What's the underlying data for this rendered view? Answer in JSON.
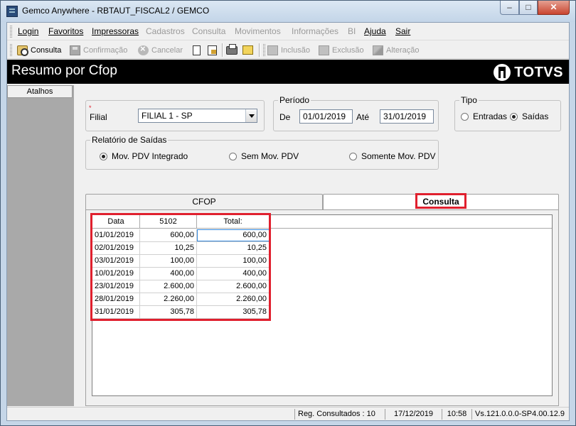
{
  "window": {
    "title": "Gemco Anywhere - RBTAUT_FISCAL2 / GEMCO",
    "min": "–",
    "max": "□",
    "close": "✕"
  },
  "menu": [
    {
      "label": "Login",
      "enabled": true
    },
    {
      "label": "Favoritos",
      "enabled": true
    },
    {
      "label": "Impressoras",
      "enabled": true
    },
    {
      "label": "Cadastros",
      "enabled": false
    },
    {
      "label": "Consulta",
      "enabled": false
    },
    {
      "label": "Movimentos",
      "enabled": false
    },
    {
      "label": "Informações",
      "enabled": false
    },
    {
      "label": "BI",
      "enabled": false
    },
    {
      "label": "Ajuda",
      "enabled": true
    },
    {
      "label": "Sair",
      "enabled": true
    }
  ],
  "toolbar": {
    "consulta": "Consulta",
    "confirmacao": "Confirmação",
    "cancelar": "Cancelar",
    "inclusao": "Inclusão",
    "exclusao": "Exclusão",
    "alteracao": "Alteração"
  },
  "header": {
    "title": "Resumo por Cfop",
    "brand": "TOTVS"
  },
  "sidebar": {
    "atalhos": "Atalhos"
  },
  "filter": {
    "filial_label": "Filial",
    "filial_value": "FILIAL 1 - SP",
    "periodo_legend": "Período",
    "de_label": "De",
    "de_value": "01/01/2019",
    "ate_label": "Até",
    "ate_value": "31/01/2019",
    "tipo_legend": "Tipo",
    "tipo_options": [
      "Entradas",
      "Saídas"
    ],
    "tipo_selected": "Saídas",
    "relatorio_legend": "Relatório de Saídas",
    "relatorio_options": [
      "Mov. PDV Integrado",
      "Sem Mov. PDV",
      "Somente Mov. PDV"
    ],
    "relatorio_selected": "Mov. PDV Integrado"
  },
  "tabs": [
    {
      "label": "CFOP",
      "active": false
    },
    {
      "label": "Consulta",
      "active": true
    }
  ],
  "grid": {
    "columns": [
      "Data",
      "5102",
      "Total:"
    ],
    "rows": [
      [
        "01/01/2019",
        "600,00",
        "600,00"
      ],
      [
        "02/01/2019",
        "10,25",
        "10,25"
      ],
      [
        "03/01/2019",
        "100,00",
        "100,00"
      ],
      [
        "10/01/2019",
        "400,00",
        "400,00"
      ],
      [
        "23/01/2019",
        "2.600,00",
        "2.600,00"
      ],
      [
        "28/01/2019",
        "2.260,00",
        "2.260,00"
      ],
      [
        "31/01/2019",
        "305,78",
        "305,78"
      ]
    ]
  },
  "status": {
    "reg": "Reg. Consultados : 10",
    "date": "17/12/2019",
    "time": "10:58",
    "version": "Vs.121.0.0.0-SP4.00.12.9"
  },
  "colors": {
    "highlight": "#e0202e",
    "header_bg": "#000000",
    "sidebar_bg": "#a9a9a9"
  }
}
